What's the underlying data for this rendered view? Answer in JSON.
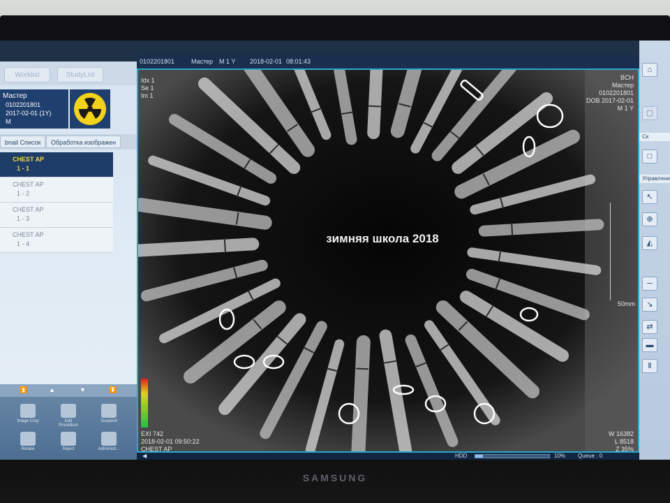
{
  "monitor": {
    "brand": "SAMSUNG"
  },
  "left_panel": {
    "tabs": [
      "Worklist",
      "StudyList"
    ],
    "patient": {
      "name": "Мастер",
      "id": "0102201801",
      "dob": "2017-02-01 (1Y)",
      "sex": "M"
    },
    "subtabs": [
      "bnail Список",
      "Обработка изображен"
    ],
    "series": [
      {
        "label": "CHEST AP",
        "index": "1 - 1",
        "selected": true
      },
      {
        "label": "CHEST AP",
        "index": "1 - 2",
        "selected": false
      },
      {
        "label": "CHEST AP",
        "index": "1 - 3",
        "selected": false
      },
      {
        "label": "CHEST AP",
        "index": "1 - 4",
        "selected": false
      }
    ],
    "tools": [
      "Image Crop",
      "Edit Procedure",
      "Suspend",
      "Retake",
      "Reject",
      "Adiministr..."
    ]
  },
  "info_bar": {
    "patient_id": "0102201801",
    "name": "Мастер",
    "sex_age": "M    1 Y",
    "date": "2018-02-01",
    "time": "08:01:43"
  },
  "overlay": {
    "top_left": [
      "Idx 1",
      "Se 1",
      "Im 1"
    ],
    "top_right": [
      "BCH",
      "Мастер",
      "0102201801",
      "DOB 2017-02-01",
      "M 1 Y"
    ],
    "center_text": "зимняя школа 2018",
    "scale_label": "50mm",
    "bottom_left": [
      "EXI 742",
      "2018-02-01  09:50:22",
      "CHEST AP"
    ],
    "bottom_right": [
      "W 16382",
      "L 8518",
      "Z 35%"
    ]
  },
  "status_bar": {
    "disk": "HDD",
    "usage": "10%",
    "usage_fraction": 0.1,
    "queue": "Queue : 0"
  },
  "right_panel": {
    "sections": [
      "Ск",
      "Управлени"
    ]
  },
  "colors": {
    "selection": "#1d3c68",
    "selection_text": "#f4d64b",
    "viewport_border": "#2aa8d0"
  }
}
